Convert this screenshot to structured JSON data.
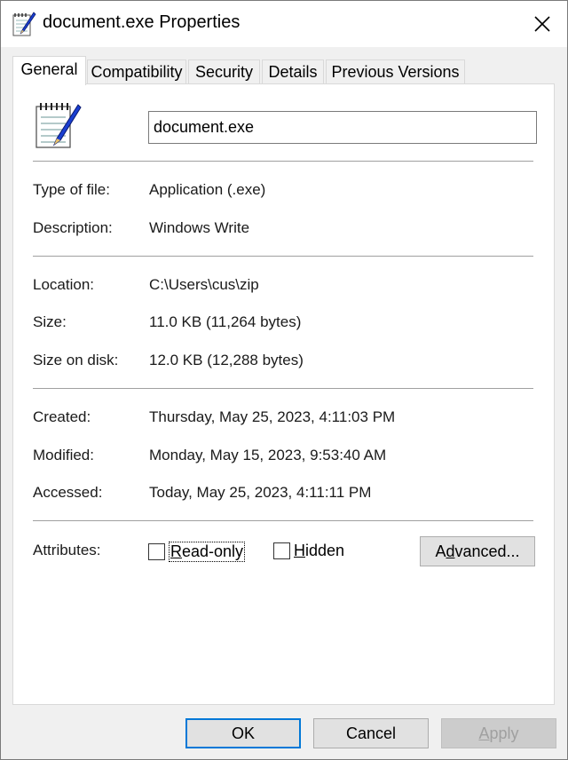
{
  "window": {
    "title": "document.exe Properties",
    "close_label": "✕"
  },
  "tabs": [
    {
      "label": "General",
      "active": true
    },
    {
      "label": "Compatibility",
      "active": false
    },
    {
      "label": "Security",
      "active": false
    },
    {
      "label": "Details",
      "active": false
    },
    {
      "label": "Previous Versions",
      "active": false
    }
  ],
  "general": {
    "file_name": "document.exe",
    "type_of_file_label": "Type of file:",
    "type_of_file": "Application (.exe)",
    "description_label": "Description:",
    "description": "Windows Write",
    "location_label": "Location:",
    "location": "C:\\Users\\cus\\zip",
    "size_label": "Size:",
    "size": "11.0 KB (11,264 bytes)",
    "size_on_disk_label": "Size on disk:",
    "size_on_disk": "12.0 KB (12,288 bytes)",
    "created_label": "Created:",
    "created": "Thursday, May 25, 2023, 4:11:03 PM",
    "modified_label": "Modified:",
    "modified": "Monday, May 15, 2023, 9:53:40 AM",
    "accessed_label": "Accessed:",
    "accessed": "Today, May 25, 2023, 4:11:11 PM",
    "attributes_label": "Attributes:",
    "readonly_pre": "",
    "readonly_mnemonic": "R",
    "readonly_post": "ead-only",
    "readonly_checked": false,
    "hidden_mnemonic": "H",
    "hidden_post": "idden",
    "hidden_checked": false,
    "advanced_pre": "A",
    "advanced_mnemonic": "d",
    "advanced_post": "vanced..."
  },
  "buttons": {
    "ok": "OK",
    "cancel": "Cancel",
    "apply_mnemonic": "A",
    "apply_post": "pply"
  },
  "colors": {
    "accent": "#0078d7",
    "dialog_bg": "#f0f0f0",
    "panel_bg": "#ffffff"
  },
  "icons": {
    "title": "notepad-pen-icon",
    "file": "notepad-pen-icon",
    "close": "close-icon"
  }
}
